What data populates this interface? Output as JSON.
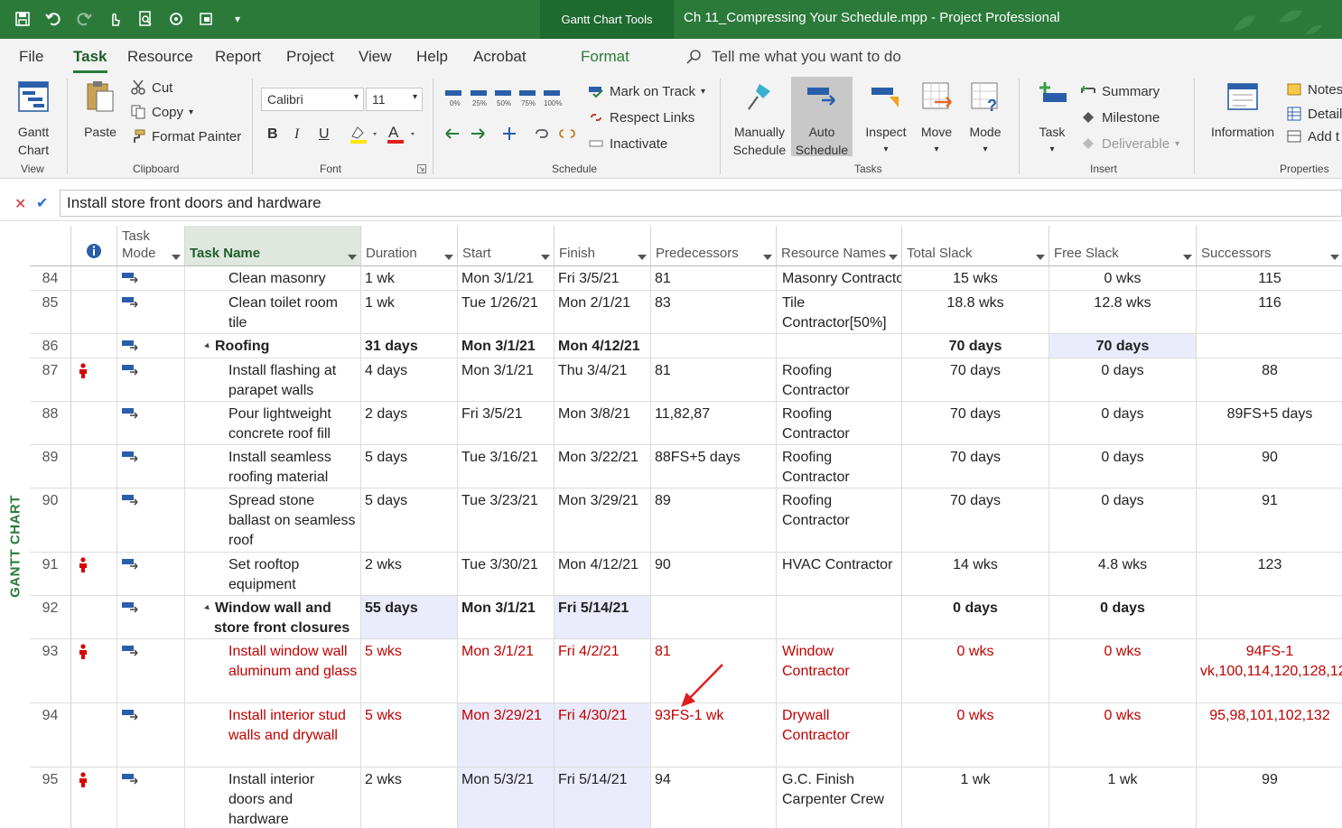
{
  "title_bar": {
    "context_tab": "Gantt Chart Tools",
    "document_title": "Ch 11_Compressing Your Schedule.mpp  -  Project Professional"
  },
  "tabs": [
    {
      "label": "File"
    },
    {
      "label": "Task"
    },
    {
      "label": "Resource"
    },
    {
      "label": "Report"
    },
    {
      "label": "Project"
    },
    {
      "label": "View"
    },
    {
      "label": "Help"
    },
    {
      "label": "Acrobat"
    },
    {
      "label": "Format"
    }
  ],
  "tell_me": "Tell me what you want to do",
  "ribbon": {
    "view": {
      "gantt_line1": "Gantt",
      "gantt_line2": "Chart",
      "label": "View"
    },
    "clipboard": {
      "paste": "Paste",
      "cut": "Cut",
      "copy": "Copy",
      "format_painter": "Format Painter",
      "label": "Clipboard"
    },
    "font": {
      "name": "Calibri",
      "size": "11",
      "bold": "B",
      "italic": "I",
      "underline": "U",
      "label": "Font"
    },
    "schedule": {
      "mark_on_track": "Mark on Track",
      "respect_links": "Respect Links",
      "inactivate": "Inactivate",
      "label": "Schedule",
      "pct": [
        "0%",
        "25%",
        "50%",
        "75%",
        "100%"
      ]
    },
    "tasks": {
      "manually_1": "Manually",
      "manually_2": "Schedule",
      "auto_1": "Auto",
      "auto_2": "Schedule",
      "inspect": "Inspect",
      "move": "Move",
      "mode": "Mode",
      "label": "Tasks"
    },
    "insert": {
      "task": "Task",
      "summary": "Summary",
      "milestone": "Milestone",
      "deliverable": "Deliverable",
      "label": "Insert"
    },
    "properties": {
      "information": "Information",
      "notes": "Notes",
      "details": "Detail",
      "add_to": "Add t",
      "label": "Properties"
    }
  },
  "formula_bar": {
    "value": "Install store front doors and hardware"
  },
  "view_label": "GANTT CHART",
  "columns": {
    "task_mode_1": "Task",
    "task_mode_2": "Mode",
    "task_name": "Task Name",
    "duration": "Duration",
    "start": "Start",
    "finish": "Finish",
    "predecessors": "Predecessors",
    "resource_names": "Resource Names",
    "total_slack": "Total Slack",
    "free_slack": "Free Slack",
    "successors": "Successors"
  },
  "rows": [
    {
      "id": "84",
      "ind": false,
      "name": [
        "Clean masonry"
      ],
      "dur": "1 wk",
      "start": "Mon 3/1/21",
      "finish": "Fri 3/5/21",
      "pred": "81",
      "res": [
        "Masonry Contracto"
      ],
      "ts": "15 wks",
      "fs": "0 wks",
      "succ": [
        "115"
      ]
    },
    {
      "id": "85",
      "ind": false,
      "name": [
        "Clean toilet room",
        "tile"
      ],
      "dur": "1 wk",
      "start": "Tue 1/26/21",
      "finish": "Mon 2/1/21",
      "pred": "83",
      "res": [
        "Tile",
        "Contractor[50%]"
      ],
      "ts": "18.8 wks",
      "fs": "12.8 wks",
      "succ": [
        "116"
      ]
    },
    {
      "id": "86",
      "ind": false,
      "summary": true,
      "name": [
        "Roofing"
      ],
      "dur": "31 days",
      "start": "Mon 3/1/21",
      "finish": "Mon 4/12/21",
      "pred": "",
      "res": [
        ""
      ],
      "ts": "70 days",
      "fs": "70 days",
      "succ": [
        ""
      ]
    },
    {
      "id": "87",
      "ind": true,
      "name": [
        "Install flashing at",
        "parapet walls"
      ],
      "dur": "4 days",
      "start": "Mon 3/1/21",
      "finish": "Thu 3/4/21",
      "pred": "81",
      "res": [
        "Roofing",
        "Contractor"
      ],
      "ts": "70 days",
      "fs": "0 days",
      "succ": [
        "88"
      ]
    },
    {
      "id": "88",
      "ind": false,
      "name": [
        "Pour lightweight",
        "concrete roof fill"
      ],
      "dur": "2 days",
      "start": "Fri 3/5/21",
      "finish": "Mon 3/8/21",
      "pred": "11,82,87",
      "res": [
        "Roofing",
        "Contractor"
      ],
      "ts": "70 days",
      "fs": "0 days",
      "succ": [
        "89FS+5 days"
      ]
    },
    {
      "id": "89",
      "ind": false,
      "name": [
        "Install seamless",
        "roofing material"
      ],
      "dur": "5 days",
      "start": "Tue 3/16/21",
      "finish": "Mon 3/22/21",
      "pred": "88FS+5 days",
      "res": [
        "Roofing",
        "Contractor"
      ],
      "ts": "70 days",
      "fs": "0 days",
      "succ": [
        "90"
      ]
    },
    {
      "id": "90",
      "ind": false,
      "name": [
        "Spread stone",
        "ballast on seamless",
        "roof"
      ],
      "dur": "5 days",
      "start": "Tue 3/23/21",
      "finish": "Mon 3/29/21",
      "pred": "89",
      "res": [
        "Roofing",
        "Contractor"
      ],
      "ts": "70 days",
      "fs": "0 days",
      "succ": [
        "91"
      ]
    },
    {
      "id": "91",
      "ind": true,
      "name": [
        "Set rooftop",
        "equipment"
      ],
      "dur": "2 wks",
      "start": "Tue 3/30/21",
      "finish": "Mon 4/12/21",
      "pred": "90",
      "res": [
        "HVAC Contractor"
      ],
      "ts": "14 wks",
      "fs": "4.8 wks",
      "succ": [
        "123"
      ]
    },
    {
      "id": "92",
      "ind": false,
      "summary": true,
      "name": [
        "Window wall and",
        "store front closures"
      ],
      "dur": "55 days",
      "start": "Mon 3/1/21",
      "finish": "Fri 5/14/21",
      "pred": "",
      "res": [
        ""
      ],
      "ts": "0 days",
      "fs": "0 days",
      "succ": [
        ""
      ]
    },
    {
      "id": "93",
      "ind": true,
      "crit": true,
      "name": [
        "Install window wall",
        "aluminum and glass"
      ],
      "dur": "5 wks",
      "start": "Mon 3/1/21",
      "finish": "Fri 4/2/21",
      "pred": "81",
      "res": [
        "Window",
        "Contractor"
      ],
      "ts": "0 wks",
      "fs": "0 wks",
      "succ": [
        "94FS-1",
        "vk,100,114,120,128,12"
      ]
    },
    {
      "id": "94",
      "ind": false,
      "crit": true,
      "name": [
        "Install interior stud",
        "walls and drywall"
      ],
      "dur": "5 wks",
      "start": "Mon 3/29/21",
      "finish": "Fri 4/30/21",
      "pred": "93FS-1 wk",
      "res": [
        "Drywall",
        "Contractor"
      ],
      "ts": "0 wks",
      "fs": "0 wks",
      "succ": [
        "95,98,101,102,132"
      ]
    },
    {
      "id": "95",
      "ind": true,
      "name": [
        "Install interior",
        "doors and",
        "hardware"
      ],
      "dur": "2 wks",
      "start": "Mon 5/3/21",
      "finish": "Fri 5/14/21",
      "pred": "94",
      "res": [
        "G.C. Finish",
        "Carpenter Crew"
      ],
      "ts": "1 wk",
      "fs": "1 wk",
      "succ": [
        "99"
      ]
    }
  ]
}
